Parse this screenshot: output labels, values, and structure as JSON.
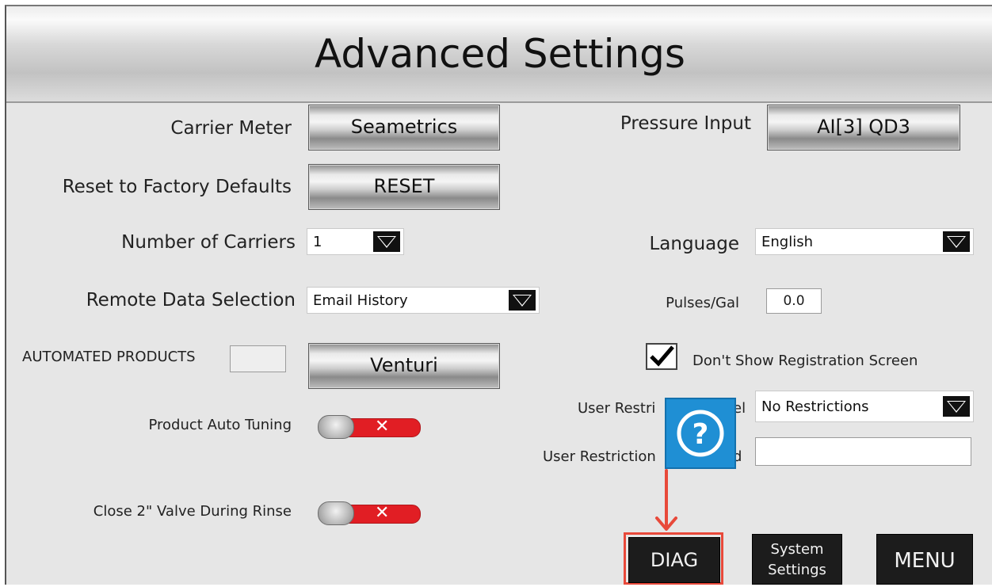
{
  "title": "Advanced Settings",
  "left": {
    "carrier_meter": {
      "label": "Carrier Meter",
      "button": "Seametrics"
    },
    "reset": {
      "label": "Reset to Factory Defaults",
      "button": "RESET"
    },
    "num_carriers": {
      "label": "Number of Carriers",
      "value": "1"
    },
    "remote_data": {
      "label": "Remote Data Selection",
      "value": "Email History"
    },
    "automated_products": {
      "label": "AUTOMATED PRODUCTS",
      "value": "",
      "button": "Venturi"
    },
    "auto_tuning": {
      "label": "Product Auto Tuning",
      "state": "off",
      "symbol": "✕"
    },
    "close_valve": {
      "label": "Close 2\" Valve During Rinse",
      "state": "off",
      "symbol": "✕"
    }
  },
  "right": {
    "pressure_input": {
      "label": "Pressure Input",
      "button": "AI[3]  QD3"
    },
    "language": {
      "label": "Language",
      "value": "English"
    },
    "pulses": {
      "label": "Pulses/Gal",
      "value": "0.0"
    },
    "registration": {
      "label": "Don't Show Registration Screen",
      "checked": true
    },
    "restriction_level": {
      "label_left": "User Restri",
      "label_right": "el",
      "value": "No Restrictions"
    },
    "restriction_password": {
      "label_left": "User Restriction",
      "label_right": "d",
      "value": ""
    }
  },
  "help": {
    "icon": "question-circle-icon",
    "color": "#1f8fd4"
  },
  "bottom": {
    "diag": "DIAG",
    "system_line1": "System",
    "system_line2": "Settings",
    "menu": "MENU"
  },
  "annotation": {
    "color": "#e8493a"
  }
}
